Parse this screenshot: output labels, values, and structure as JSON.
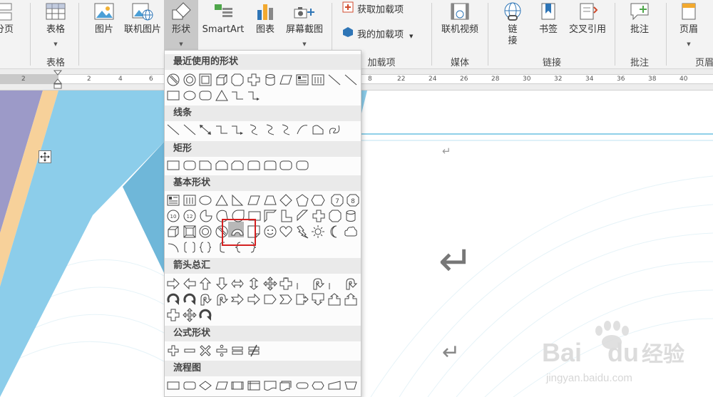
{
  "ribbon": {
    "buttons": {
      "page_break_partial": "分页",
      "table": "表格",
      "picture": "图片",
      "online_picture": "联机图片",
      "shapes": "形状",
      "smartart": "SmartArt",
      "chart": "图表",
      "screenshot": "屏幕截图",
      "get_addins": "获取加载项",
      "my_addins": "我的加载项",
      "online_video": "联机视频",
      "link_line1": "链",
      "link_line2": "接",
      "bookmark": "书签",
      "cross_reference": "交叉引用",
      "comment": "批注",
      "header": "页眉"
    },
    "groups": {
      "tables": "表格",
      "addins": "加载项",
      "media": "媒体",
      "links": "链接",
      "comments": "批注",
      "header_footer": "页眉"
    }
  },
  "ruler": {
    "numbers": [
      "2",
      "2",
      "4",
      "6",
      "8",
      "22",
      "24",
      "26",
      "28",
      "30",
      "32",
      "34",
      "36",
      "38",
      "40"
    ]
  },
  "shapes_menu": {
    "categories": {
      "recent": "最近使用的形状",
      "lines": "线条",
      "rectangles": "矩形",
      "basic": "基本形状",
      "block_arrows": "箭头总汇",
      "equation": "公式形状",
      "flowchart": "流程图"
    },
    "basic_numbers": [
      "7",
      "8",
      "10",
      "12"
    ]
  },
  "document": {
    "paragraph_mark": "↵"
  },
  "watermark": {
    "text": "Bai",
    "text2": "du",
    "cn": "经验",
    "url": "jingyan.baidu.com"
  },
  "colors": {
    "ribbon_bg": "#f3f3f3",
    "highlight_red": "#d42121",
    "doc_blue": "#8ccdea",
    "doc_purple": "#9c9ac8",
    "doc_peach": "#f7d19a"
  }
}
